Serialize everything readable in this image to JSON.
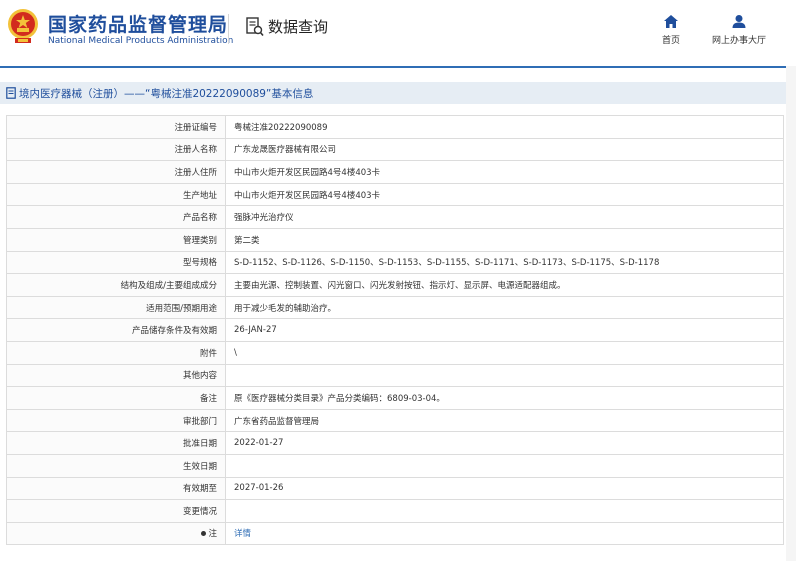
{
  "header": {
    "site_name_cn": "国家药品监督管理局",
    "site_name_en": "National Medical Products Administration",
    "query_label": "数据查询",
    "nav": [
      {
        "label": "首页",
        "icon": "home-icon"
      },
      {
        "label": "网上办事大厅",
        "icon": "user-icon"
      }
    ]
  },
  "page": {
    "title": "境内医疗器械（注册）——“粤械注准20222090089”基本信息"
  },
  "rows": [
    {
      "label": "注册证编号",
      "value": "粤械注准20222090089"
    },
    {
      "label": "注册人名称",
      "value": "广东龙晟医疗器械有限公司"
    },
    {
      "label": "注册人住所",
      "value": "中山市火炬开发区民园路4号4楼403卡"
    },
    {
      "label": "生产地址",
      "value": "中山市火炬开发区民园路4号4楼403卡"
    },
    {
      "label": "产品名称",
      "value": "强脉冲光治疗仪"
    },
    {
      "label": "管理类别",
      "value": "第二类"
    },
    {
      "label": "型号规格",
      "value": "S-D-1152、S-D-1126、S-D-1150、S-D-1153、S-D-1155、S-D-1171、S-D-1173、S-D-1175、S-D-1178"
    },
    {
      "label": "结构及组成/主要组成成分",
      "value": "主要由光源、控制装置、闪光窗口、闪光发射按钮、指示灯、显示屏、电源适配器组成。"
    },
    {
      "label": "适用范围/预期用途",
      "value": "用于减少毛发的辅助治疗。"
    },
    {
      "label": "产品储存条件及有效期",
      "value": "26-JAN-27"
    },
    {
      "label": "附件",
      "value": "\\"
    },
    {
      "label": "其他内容",
      "value": ""
    },
    {
      "label": "备注",
      "value": "原《医疗器械分类目录》产品分类编码：6809-03-04。"
    },
    {
      "label": "审批部门",
      "value": "广东省药品监督管理局"
    },
    {
      "label": "批准日期",
      "value": "2022-01-27"
    },
    {
      "label": "生效日期",
      "value": ""
    },
    {
      "label": "有效期至",
      "value": "2027-01-26"
    },
    {
      "label": "变更情况",
      "value": ""
    }
  ],
  "note_row": {
    "label": "注",
    "link": "详情"
  },
  "colors": {
    "brand_blue": "#1f4e9c",
    "title_bg": "#e6edf4",
    "emblem_red": "#d22b1e",
    "emblem_gold": "#f3c23a"
  }
}
